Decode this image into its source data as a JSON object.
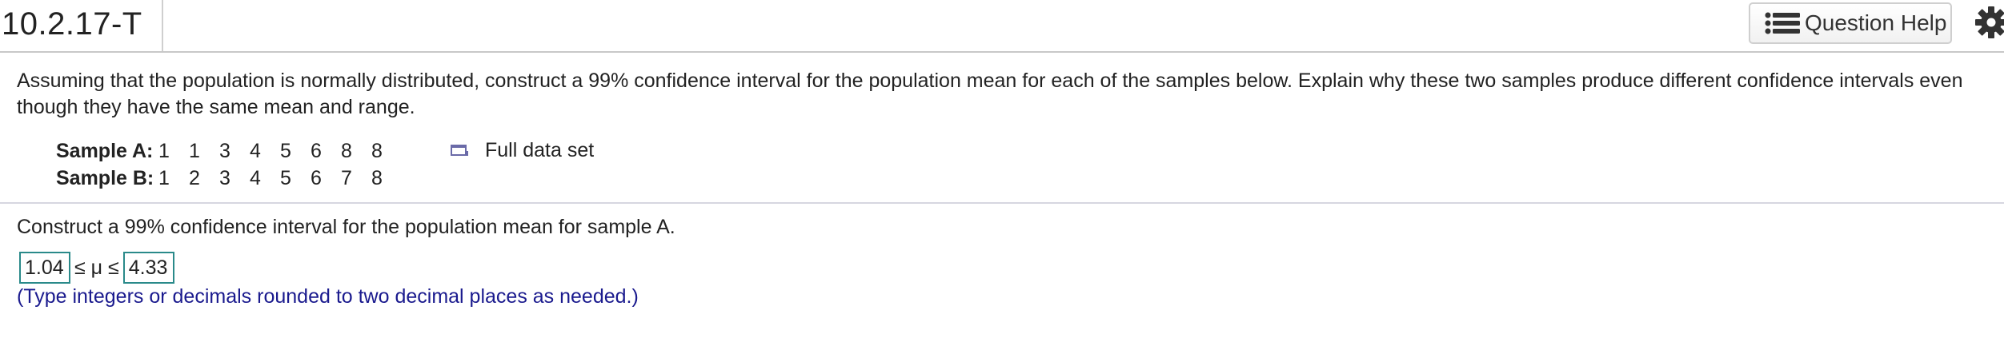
{
  "header": {
    "question_id": "10.2.17-T",
    "help_button_label": "Question Help",
    "help_icon": "list-icon",
    "settings_icon": "gear-icon"
  },
  "prompt": {
    "text": "Assuming that the population is normally distributed, construct a 99% confidence interval for the population mean for each of the samples below. Explain why these two samples produce different confidence intervals even though they have the same mean and range."
  },
  "samples": [
    {
      "label": "Sample A:",
      "values": [
        "1",
        "1",
        "3",
        "4",
        "5",
        "6",
        "8",
        "8"
      ]
    },
    {
      "label": "Sample B:",
      "values": [
        "1",
        "2",
        "3",
        "4",
        "5",
        "6",
        "7",
        "8"
      ]
    }
  ],
  "full_data_set": {
    "label": "Full data set",
    "icon": "popup-window-icon"
  },
  "question": {
    "text": "Construct a 99% confidence interval for the population mean for sample A.",
    "lower": "1.04",
    "symbol": "≤ μ ≤",
    "upper": "4.33",
    "hint": "(Type integers or decimals rounded to two decimal places as needed.)"
  },
  "colors": {
    "answer_border": "#2a8a8a",
    "hint_text": "#1a1a8e"
  }
}
